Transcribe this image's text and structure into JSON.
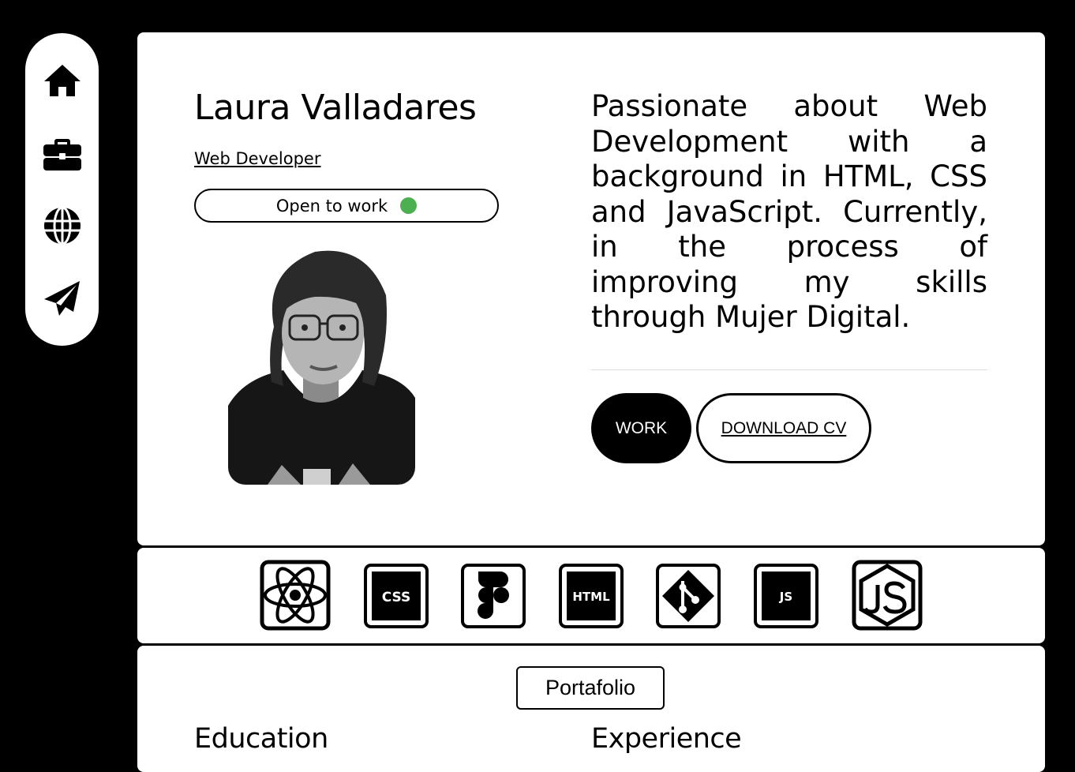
{
  "nav": {
    "items": [
      {
        "name": "home",
        "icon": "home-icon"
      },
      {
        "name": "work",
        "icon": "briefcase-icon"
      },
      {
        "name": "web",
        "icon": "globe-icon"
      },
      {
        "name": "contact",
        "icon": "paper-plane-icon"
      }
    ]
  },
  "profile": {
    "name": "Laura Valladares",
    "role": "Web Developer",
    "status": "Open to work",
    "status_color": "#4caf50"
  },
  "bio": "Passionate about Web Development with a background in HTML, CSS and JavaScript. Currently, in the process of improving my skills through Mujer Digital.",
  "buttons": {
    "work": "WORK",
    "download_cv": "DOWNLOAD CV"
  },
  "skills": {
    "items": [
      {
        "icon": "react-icon"
      },
      {
        "icon": "css-icon",
        "label": "CSS"
      },
      {
        "icon": "figma-icon"
      },
      {
        "icon": "html-icon",
        "label": "HTML"
      },
      {
        "icon": "git-icon"
      },
      {
        "icon": "javascript-icon",
        "label": "JS"
      },
      {
        "icon": "nodejs-icon"
      }
    ]
  },
  "portfolio": {
    "button": "Portafolio",
    "education_title": "Education",
    "experience_title": "Experience"
  }
}
